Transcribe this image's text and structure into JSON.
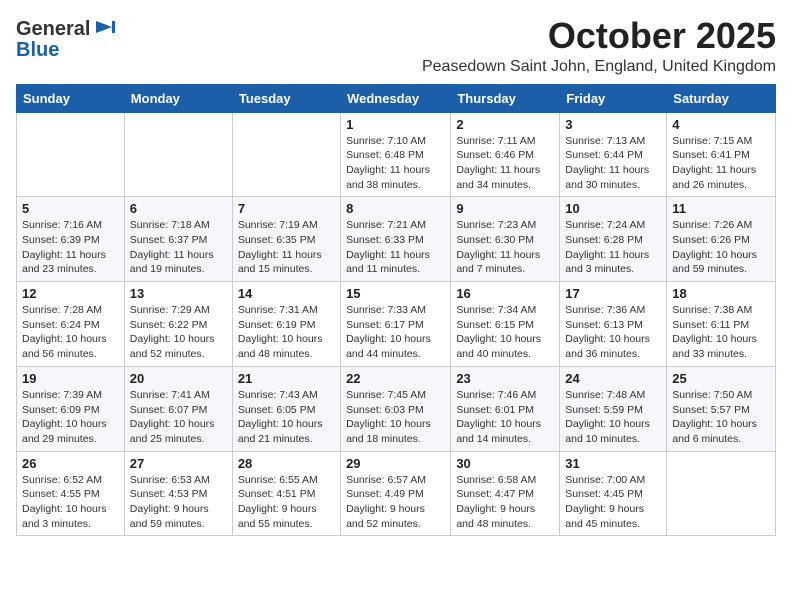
{
  "header": {
    "logo_general": "General",
    "logo_blue": "Blue",
    "month": "October 2025",
    "location": "Peasedown Saint John, England, United Kingdom"
  },
  "days_of_week": [
    "Sunday",
    "Monday",
    "Tuesday",
    "Wednesday",
    "Thursday",
    "Friday",
    "Saturday"
  ],
  "weeks": [
    [
      {
        "day": "",
        "info": ""
      },
      {
        "day": "",
        "info": ""
      },
      {
        "day": "",
        "info": ""
      },
      {
        "day": "1",
        "info": "Sunrise: 7:10 AM\nSunset: 6:48 PM\nDaylight: 11 hours\nand 38 minutes."
      },
      {
        "day": "2",
        "info": "Sunrise: 7:11 AM\nSunset: 6:46 PM\nDaylight: 11 hours\nand 34 minutes."
      },
      {
        "day": "3",
        "info": "Sunrise: 7:13 AM\nSunset: 6:44 PM\nDaylight: 11 hours\nand 30 minutes."
      },
      {
        "day": "4",
        "info": "Sunrise: 7:15 AM\nSunset: 6:41 PM\nDaylight: 11 hours\nand 26 minutes."
      }
    ],
    [
      {
        "day": "5",
        "info": "Sunrise: 7:16 AM\nSunset: 6:39 PM\nDaylight: 11 hours\nand 23 minutes."
      },
      {
        "day": "6",
        "info": "Sunrise: 7:18 AM\nSunset: 6:37 PM\nDaylight: 11 hours\nand 19 minutes."
      },
      {
        "day": "7",
        "info": "Sunrise: 7:19 AM\nSunset: 6:35 PM\nDaylight: 11 hours\nand 15 minutes."
      },
      {
        "day": "8",
        "info": "Sunrise: 7:21 AM\nSunset: 6:33 PM\nDaylight: 11 hours\nand 11 minutes."
      },
      {
        "day": "9",
        "info": "Sunrise: 7:23 AM\nSunset: 6:30 PM\nDaylight: 11 hours\nand 7 minutes."
      },
      {
        "day": "10",
        "info": "Sunrise: 7:24 AM\nSunset: 6:28 PM\nDaylight: 11 hours\nand 3 minutes."
      },
      {
        "day": "11",
        "info": "Sunrise: 7:26 AM\nSunset: 6:26 PM\nDaylight: 10 hours\nand 59 minutes."
      }
    ],
    [
      {
        "day": "12",
        "info": "Sunrise: 7:28 AM\nSunset: 6:24 PM\nDaylight: 10 hours\nand 56 minutes."
      },
      {
        "day": "13",
        "info": "Sunrise: 7:29 AM\nSunset: 6:22 PM\nDaylight: 10 hours\nand 52 minutes."
      },
      {
        "day": "14",
        "info": "Sunrise: 7:31 AM\nSunset: 6:19 PM\nDaylight: 10 hours\nand 48 minutes."
      },
      {
        "day": "15",
        "info": "Sunrise: 7:33 AM\nSunset: 6:17 PM\nDaylight: 10 hours\nand 44 minutes."
      },
      {
        "day": "16",
        "info": "Sunrise: 7:34 AM\nSunset: 6:15 PM\nDaylight: 10 hours\nand 40 minutes."
      },
      {
        "day": "17",
        "info": "Sunrise: 7:36 AM\nSunset: 6:13 PM\nDaylight: 10 hours\nand 36 minutes."
      },
      {
        "day": "18",
        "info": "Sunrise: 7:38 AM\nSunset: 6:11 PM\nDaylight: 10 hours\nand 33 minutes."
      }
    ],
    [
      {
        "day": "19",
        "info": "Sunrise: 7:39 AM\nSunset: 6:09 PM\nDaylight: 10 hours\nand 29 minutes."
      },
      {
        "day": "20",
        "info": "Sunrise: 7:41 AM\nSunset: 6:07 PM\nDaylight: 10 hours\nand 25 minutes."
      },
      {
        "day": "21",
        "info": "Sunrise: 7:43 AM\nSunset: 6:05 PM\nDaylight: 10 hours\nand 21 minutes."
      },
      {
        "day": "22",
        "info": "Sunrise: 7:45 AM\nSunset: 6:03 PM\nDaylight: 10 hours\nand 18 minutes."
      },
      {
        "day": "23",
        "info": "Sunrise: 7:46 AM\nSunset: 6:01 PM\nDaylight: 10 hours\nand 14 minutes."
      },
      {
        "day": "24",
        "info": "Sunrise: 7:48 AM\nSunset: 5:59 PM\nDaylight: 10 hours\nand 10 minutes."
      },
      {
        "day": "25",
        "info": "Sunrise: 7:50 AM\nSunset: 5:57 PM\nDaylight: 10 hours\nand 6 minutes."
      }
    ],
    [
      {
        "day": "26",
        "info": "Sunrise: 6:52 AM\nSunset: 4:55 PM\nDaylight: 10 hours\nand 3 minutes."
      },
      {
        "day": "27",
        "info": "Sunrise: 6:53 AM\nSunset: 4:53 PM\nDaylight: 9 hours\nand 59 minutes."
      },
      {
        "day": "28",
        "info": "Sunrise: 6:55 AM\nSunset: 4:51 PM\nDaylight: 9 hours\nand 55 minutes."
      },
      {
        "day": "29",
        "info": "Sunrise: 6:57 AM\nSunset: 4:49 PM\nDaylight: 9 hours\nand 52 minutes."
      },
      {
        "day": "30",
        "info": "Sunrise: 6:58 AM\nSunset: 4:47 PM\nDaylight: 9 hours\nand 48 minutes."
      },
      {
        "day": "31",
        "info": "Sunrise: 7:00 AM\nSunset: 4:45 PM\nDaylight: 9 hours\nand 45 minutes."
      },
      {
        "day": "",
        "info": ""
      }
    ]
  ]
}
